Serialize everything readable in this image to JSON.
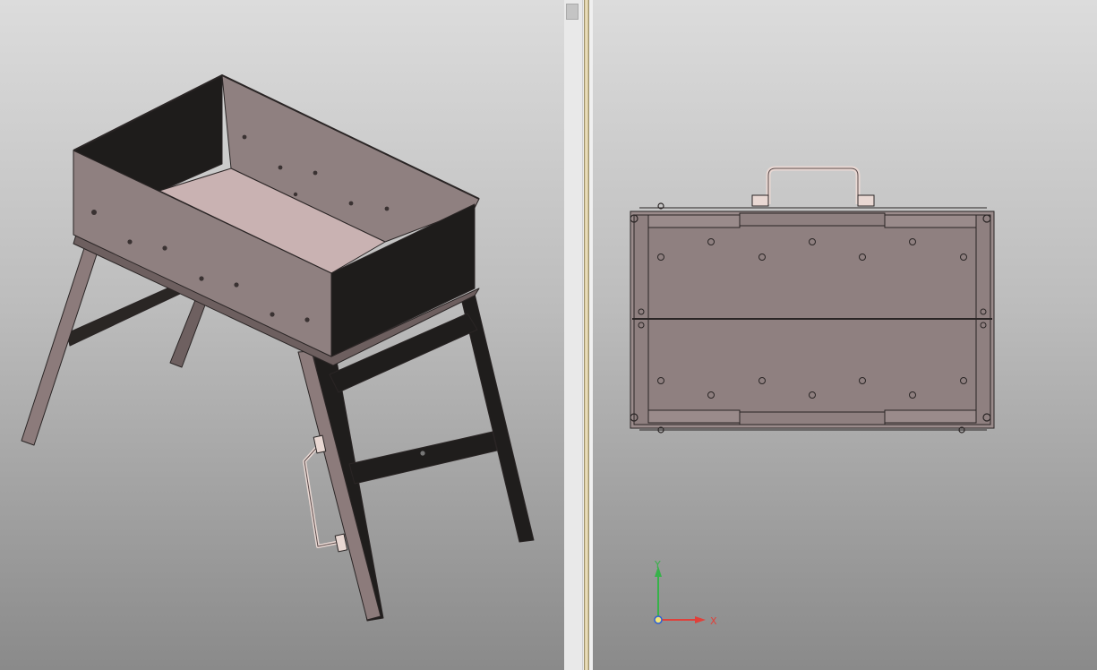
{
  "views": {
    "left": {
      "type": "isometric"
    },
    "right": {
      "type": "top"
    }
  },
  "triad": {
    "x_label": "X",
    "y_label": "Y",
    "x_color": "#e0403a",
    "y_color": "#37b24a",
    "origin_color": "#2b5fd6"
  },
  "colors": {
    "panel": "#8f8080",
    "dark": "#1e1c1b",
    "floor": "#c9b2b2",
    "handle": "#e9d8d3",
    "edge": "#2a2525"
  }
}
